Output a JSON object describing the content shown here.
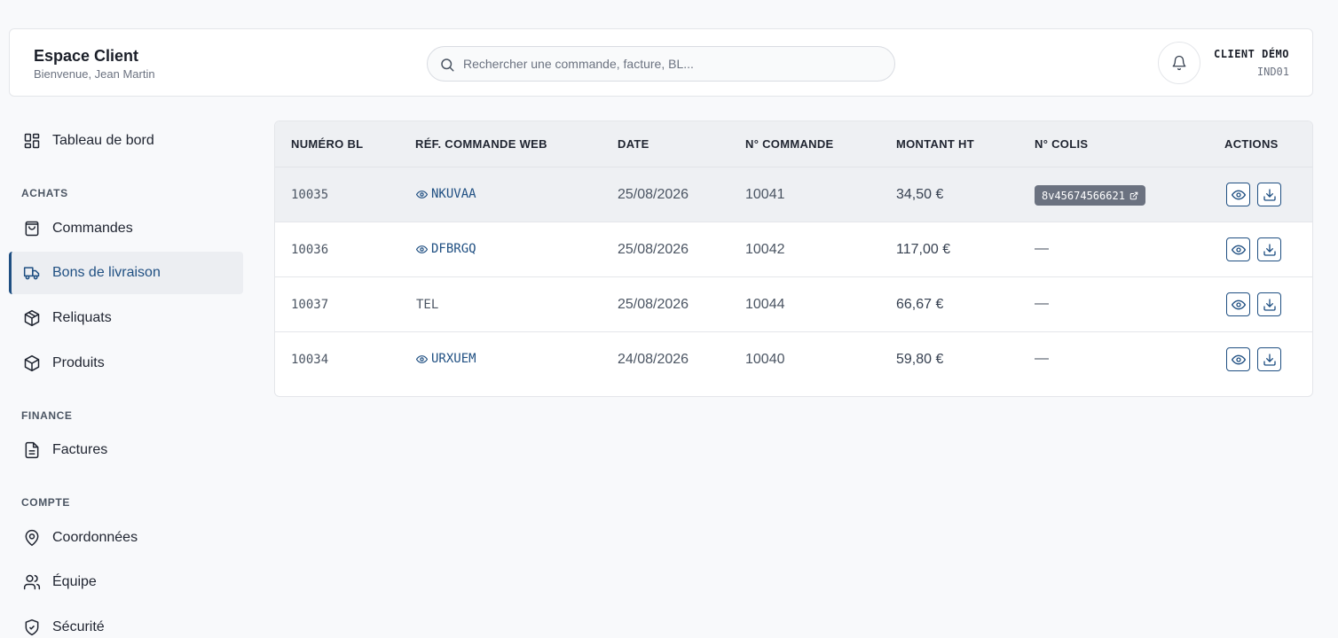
{
  "header": {
    "title": "Espace Client",
    "subtitle": "Bienvenue, Jean Martin",
    "search_placeholder": "Rechercher une commande, facture, BL...",
    "client_name": "CLIENT DÉMO",
    "client_code": "IND01"
  },
  "sidebar": {
    "dashboard": "Tableau de bord",
    "sections": {
      "achats": "ACHATS",
      "finance": "FINANCE",
      "compte": "COMPTE"
    },
    "items": {
      "commandes": "Commandes",
      "bons": "Bons de livraison",
      "reliquats": "Reliquats",
      "produits": "Produits",
      "factures": "Factures",
      "coordonnees": "Coordonnées",
      "equipe": "Équipe",
      "securite": "Sécurité"
    },
    "active": "bons"
  },
  "table": {
    "columns": [
      "NUMÉRO BL",
      "RÉF. COMMANDE WEB",
      "DATE",
      "N° COMMANDE",
      "MONTANT HT",
      "N° COLIS",
      "ACTIONS"
    ],
    "rows": [
      {
        "bl": "10035",
        "ref": "NKUVAA",
        "ref_link": true,
        "date": "25/08/2026",
        "commande": "10041",
        "montant": "34,50 €",
        "colis": "8v45674566621"
      },
      {
        "bl": "10036",
        "ref": "DFBRGQ",
        "ref_link": true,
        "date": "25/08/2026",
        "commande": "10042",
        "montant": "117,00 €",
        "colis": "—"
      },
      {
        "bl": "10037",
        "ref": "TEL",
        "ref_link": false,
        "date": "25/08/2026",
        "commande": "10044",
        "montant": "66,67 €",
        "colis": "—"
      },
      {
        "bl": "10034",
        "ref": "URXUEM",
        "ref_link": true,
        "date": "24/08/2026",
        "commande": "10040",
        "montant": "59,80 €",
        "colis": "—"
      }
    ]
  },
  "colors": {
    "accent": "#1f4f82",
    "badge": "#6b7280"
  }
}
